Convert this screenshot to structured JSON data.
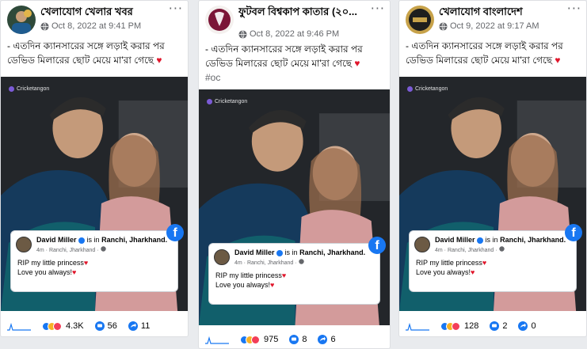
{
  "post_text": "- এতদিন ক্যানসারের সঙ্গে লড়াই করার পর ডেভিড মিলারের ছোট মেয়ে মা'রা গেছে",
  "heart": "♥",
  "overflow_menu": "···",
  "posts": [
    {
      "page_name": "খেলাযোগ খেলার খবর",
      "timestamp": "Oct 8, 2022 at 9:41 PM",
      "hashtag": "",
      "reactions": "4.3K",
      "comments": "56",
      "shares": "11"
    },
    {
      "page_name": "ফুটবল বিশ্বকাপ কাতার (২০...",
      "timestamp": "Oct 8, 2022 at 9:46 PM",
      "hashtag": "#oc",
      "reactions": "975",
      "comments": "8",
      "shares": "6"
    },
    {
      "page_name": "খেলাযোগ বাংলাদেশ",
      "timestamp": "Oct 9, 2022 at 9:17 AM",
      "hashtag": "",
      "reactions": "128",
      "comments": "2",
      "shares": "0"
    }
  ],
  "embedded": {
    "watermark": "Cricketangon",
    "name": "David Miller",
    "is_in": "is in",
    "place": "Ranchi, Jharkhand.",
    "sub": "4m · Ranchi, Jharkhand · ",
    "line1": "RIP my little princess",
    "line2": "Love you always!",
    "fb_letter": "f"
  },
  "colors": {
    "facebook_blue": "#1877f2",
    "heart_red": "#e0162b",
    "meta_gray": "#65676b"
  }
}
